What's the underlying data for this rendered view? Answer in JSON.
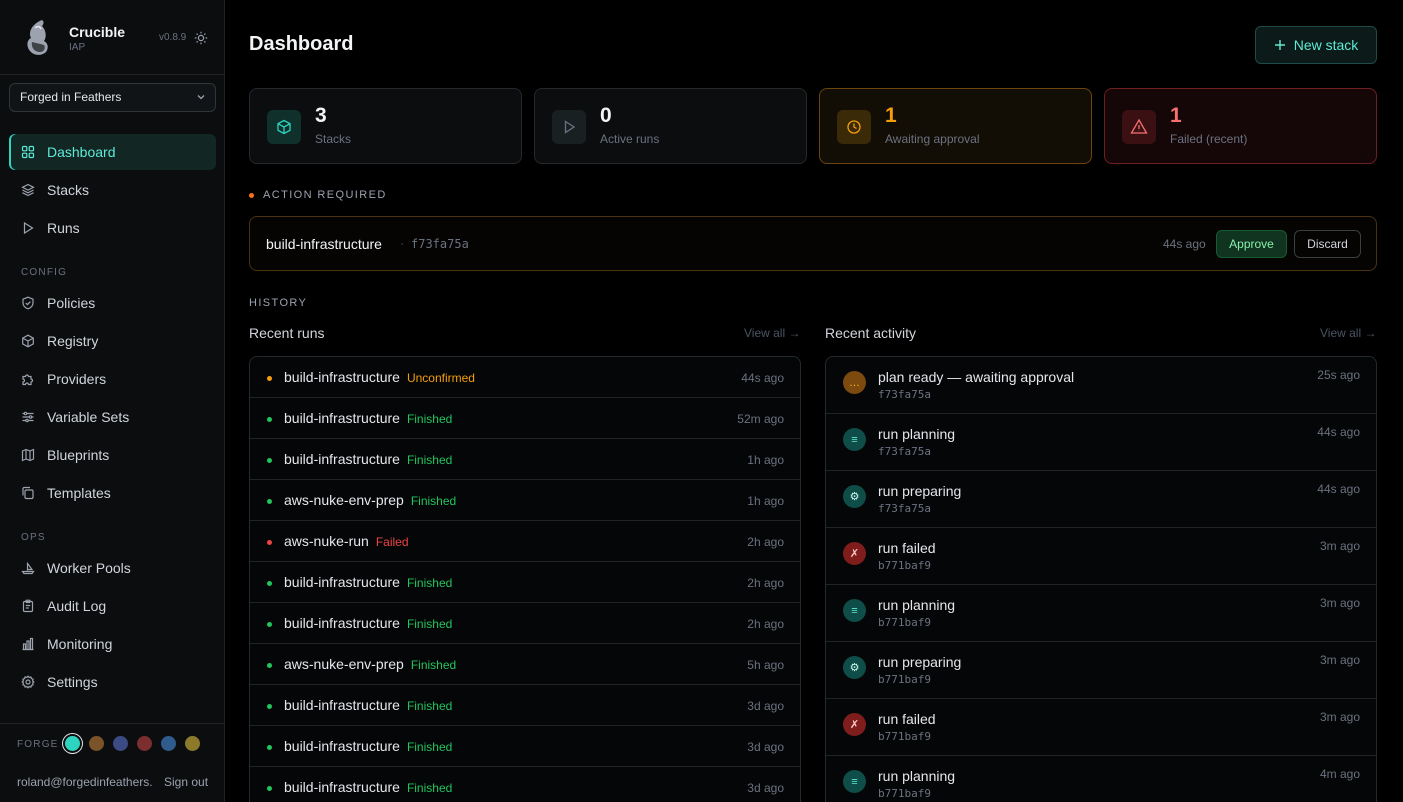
{
  "brand": {
    "name": "Crucible",
    "sub": "IAP",
    "version": "v0.8.9"
  },
  "org_select": {
    "value": "Forged in Feathers"
  },
  "nav": {
    "main": [
      {
        "label": "Dashboard",
        "icon": "grid-icon",
        "active": true
      },
      {
        "label": "Stacks",
        "icon": "layers-icon"
      },
      {
        "label": "Runs",
        "icon": "play-icon"
      }
    ],
    "config_label": "CONFIG",
    "config": [
      {
        "label": "Policies",
        "icon": "shield-icon"
      },
      {
        "label": "Registry",
        "icon": "box-icon"
      },
      {
        "label": "Providers",
        "icon": "puzzle-icon"
      },
      {
        "label": "Variable Sets",
        "icon": "sliders-icon"
      },
      {
        "label": "Blueprints",
        "icon": "map-icon"
      },
      {
        "label": "Templates",
        "icon": "copy-icon"
      }
    ],
    "ops_label": "OPS",
    "ops": [
      {
        "label": "Worker Pools",
        "icon": "sailboat-icon"
      },
      {
        "label": "Audit Log",
        "icon": "clipboard-icon"
      },
      {
        "label": "Monitoring",
        "icon": "bar-chart-icon"
      },
      {
        "label": "Settings",
        "icon": "gear-icon"
      }
    ]
  },
  "forge": {
    "label": "FORGE",
    "swatches": [
      "#2dd4bf",
      "#7a5428",
      "#3b4a82",
      "#7a2e2e",
      "#2f5c8c",
      "#8c7a2a"
    ]
  },
  "user": {
    "email": "roland@forgedinfeathers.com",
    "signout": "Sign out"
  },
  "header": {
    "title": "Dashboard",
    "new_stack": "New stack"
  },
  "stats": [
    {
      "value": "3",
      "label": "Stacks",
      "icon": "cube-icon"
    },
    {
      "value": "0",
      "label": "Active runs",
      "icon": "play-icon"
    },
    {
      "value": "1",
      "label": "Awaiting approval",
      "icon": "clock-icon"
    },
    {
      "value": "1",
      "label": "Failed (recent)",
      "icon": "warning-icon"
    }
  ],
  "action_required": {
    "label": "ACTION REQUIRED",
    "stack": "build-infrastructure",
    "separator": "·",
    "hash": "f73fa75a",
    "time": "44s ago",
    "approve": "Approve",
    "discard": "Discard"
  },
  "history": {
    "label": "HISTORY",
    "runs_title": "Recent runs",
    "activity_title": "Recent activity",
    "view_all": "View all →"
  },
  "runs": [
    {
      "name": "build-infrastructure",
      "status": "Unconfirmed",
      "time": "44s ago",
      "state": "unconfirmed"
    },
    {
      "name": "build-infrastructure",
      "status": "Finished",
      "time": "52m ago",
      "state": "finished"
    },
    {
      "name": "build-infrastructure",
      "status": "Finished",
      "time": "1h ago",
      "state": "finished"
    },
    {
      "name": "aws-nuke-env-prep",
      "status": "Finished",
      "time": "1h ago",
      "state": "finished"
    },
    {
      "name": "aws-nuke-run",
      "status": "Failed",
      "time": "2h ago",
      "state": "failed"
    },
    {
      "name": "build-infrastructure",
      "status": "Finished",
      "time": "2h ago",
      "state": "finished"
    },
    {
      "name": "build-infrastructure",
      "status": "Finished",
      "time": "2h ago",
      "state": "finished"
    },
    {
      "name": "aws-nuke-env-prep",
      "status": "Finished",
      "time": "5h ago",
      "state": "finished"
    },
    {
      "name": "build-infrastructure",
      "status": "Finished",
      "time": "3d ago",
      "state": "finished"
    },
    {
      "name": "build-infrastructure",
      "status": "Finished",
      "time": "3d ago",
      "state": "finished"
    },
    {
      "name": "build-infrastructure",
      "status": "Finished",
      "time": "3d ago",
      "state": "finished"
    }
  ],
  "activity": [
    {
      "title": "plan ready — awaiting approval",
      "hash": "f73fa75a",
      "time": "25s ago",
      "kind": "pending",
      "glyph": "…"
    },
    {
      "title": "run planning",
      "hash": "f73fa75a",
      "time": "44s ago",
      "kind": "planning",
      "glyph": "≡"
    },
    {
      "title": "run preparing",
      "hash": "f73fa75a",
      "time": "44s ago",
      "kind": "preparing",
      "glyph": "⚙"
    },
    {
      "title": "run failed",
      "hash": "b771baf9",
      "time": "3m ago",
      "kind": "failed",
      "glyph": "✗"
    },
    {
      "title": "run planning",
      "hash": "b771baf9",
      "time": "3m ago",
      "kind": "planning",
      "glyph": "≡"
    },
    {
      "title": "run preparing",
      "hash": "b771baf9",
      "time": "3m ago",
      "kind": "preparing",
      "glyph": "⚙"
    },
    {
      "title": "run failed",
      "hash": "b771baf9",
      "time": "3m ago",
      "kind": "failed",
      "glyph": "✗"
    },
    {
      "title": "run planning",
      "hash": "b771baf9",
      "time": "4m ago",
      "kind": "planning",
      "glyph": "≡"
    }
  ],
  "colors": {
    "accent": "#2dd4bf",
    "finished": "#22c55e",
    "unconfirmed": "#f59e0b",
    "failed": "#ef4444"
  }
}
